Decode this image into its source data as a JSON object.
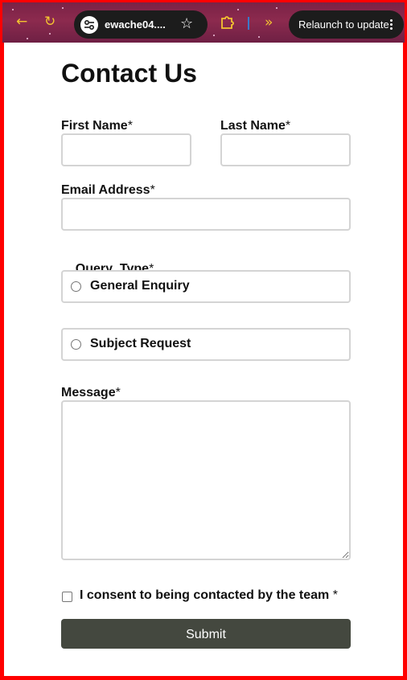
{
  "browser": {
    "url_text": "ewache04....",
    "relaunch_label": "Relaunch to update"
  },
  "page": {
    "title": "Contact Us"
  },
  "form": {
    "first_name_label": "First Name",
    "last_name_label": "Last Name",
    "email_label": "Email Address",
    "query_type_label": "Query  Type",
    "required_mark": "*",
    "query_options": [
      {
        "label": "General Enquiry",
        "checked": false
      },
      {
        "label": "Subject Request",
        "checked": false
      }
    ],
    "message_label": "Message",
    "consent_label": "I consent to being contacted by the team",
    "consent_required_mark": " *",
    "submit_label": "Submit",
    "first_name_value": "",
    "last_name_value": "",
    "email_value": "",
    "message_value": ""
  },
  "colors": {
    "frame": "#ff0000",
    "submit_bg": "#44483f",
    "field_border": "#d4d4d4",
    "accent_icon": "#f4c430"
  },
  "icons": {
    "back": "arrow-left-icon",
    "reload": "reload-icon",
    "site_info": "tune-icon",
    "bookmark": "star-icon",
    "extensions": "puzzle-icon",
    "more_tools": "chevron-double-right-icon",
    "menu": "kebab-menu-icon"
  }
}
